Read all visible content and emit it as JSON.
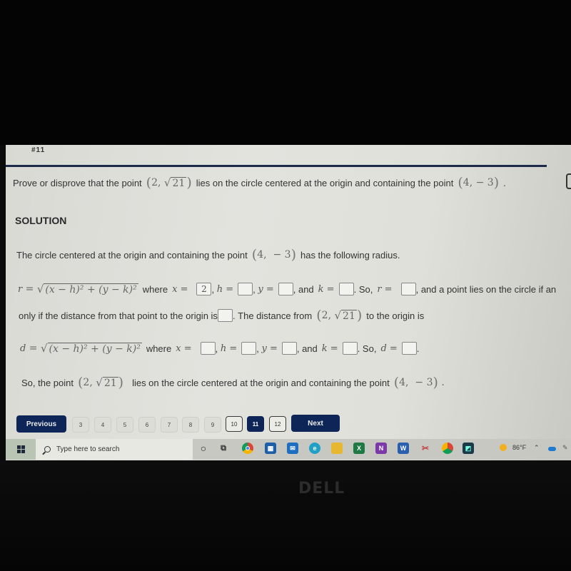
{
  "question_number": "#11",
  "prompt": {
    "pre": "Prove or disprove that the point",
    "point1": {
      "x": "2",
      "y_radicand": "21"
    },
    "mid": "lies on the circle centered at the origin and containing the point",
    "point2": {
      "x": "4",
      "y": "− 3"
    },
    "end": "."
  },
  "solution_heading": "SOLUTION",
  "intro": {
    "pre": "The circle centered at the origin and containing the point",
    "post": "has the following radius."
  },
  "radius_formula": {
    "lhs": "r",
    "radicand": "(x − h)² + (y − k)²",
    "where": "where",
    "x_label": "x =",
    "h_label": "h =",
    "y_label": "y =",
    "and": "and",
    "k_label": "k =",
    "so": "So,",
    "r_label": "r =",
    "tail": "and a point lies on the circle if an",
    "answers": {
      "x": "2",
      "h": "",
      "y": "",
      "k": "",
      "r": ""
    }
  },
  "distance_line": {
    "pre": "only if the distance from that point to the origin is",
    "mid": "The distance from",
    "post": "to the origin is",
    "answer": ""
  },
  "distance_formula": {
    "lhs": "d",
    "radicand": "(x − h)² + (y − k)²",
    "where": "where",
    "x_label": "x =",
    "h_label": "h =",
    "y_label": "y =",
    "and": "and",
    "k_label": "k =",
    "so": "So,",
    "d_label": "d =",
    "answers": {
      "x": "",
      "h": "",
      "y": "",
      "k": "",
      "d": ""
    }
  },
  "conclusion": {
    "pre": "So, the point",
    "post": "lies on the circle centered at the origin and containing the point"
  },
  "navigation": {
    "previous": "Previous",
    "next": "Next",
    "pages": [
      "3",
      "4",
      "5",
      "6",
      "7",
      "8",
      "9",
      "10",
      "11",
      "12"
    ],
    "visited": [
      "10",
      "12"
    ],
    "current": "11"
  },
  "taskbar": {
    "search_placeholder": "Type here to search",
    "weather": "86°F",
    "apps": [
      "cortana",
      "task-view",
      "chrome",
      "store",
      "mail",
      "edge",
      "file-explorer",
      "excel",
      "onenote",
      "word",
      "snipping-tool",
      "chrome-profile",
      "app"
    ]
  },
  "brand": "DELL",
  "colors": {
    "accent": "#0d2557",
    "rule": "#1d2a4a"
  }
}
